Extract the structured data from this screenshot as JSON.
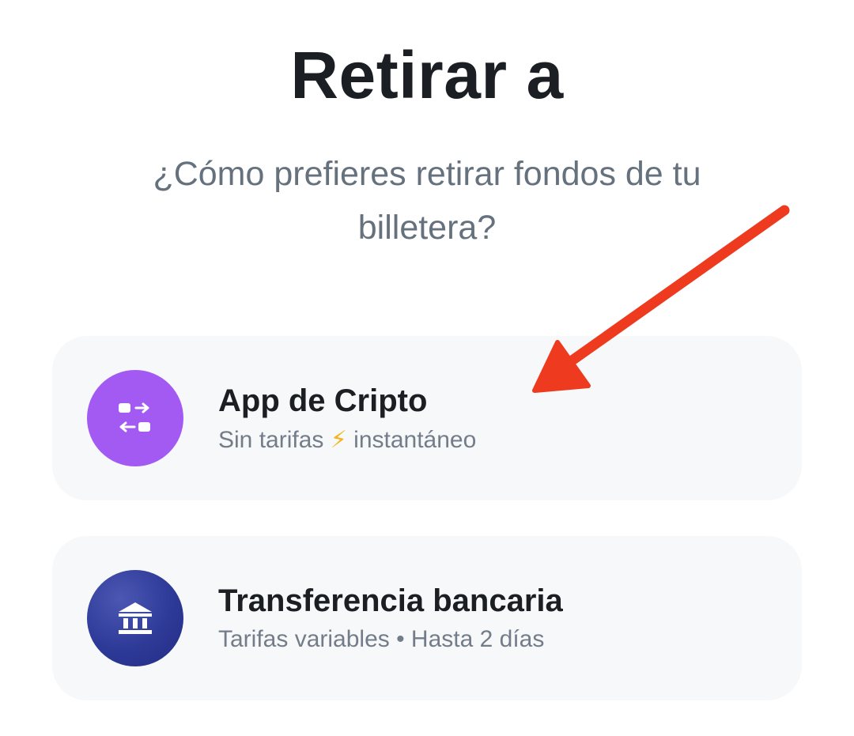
{
  "header": {
    "title": "Retirar a",
    "subtitle": "¿Cómo prefieres retirar fondos de tu billetera?"
  },
  "options": [
    {
      "title": "App de Cripto",
      "subtitle_before": "Sin tarifas",
      "subtitle_icon": "⚡",
      "subtitle_after": "instantáneo",
      "icon": "transfer-icon",
      "color": "#a35af3"
    },
    {
      "title": "Transferencia bancaria",
      "subtitle": "Tarifas variables • Hasta 2 días",
      "icon": "bank-icon",
      "color": "#2e3a97"
    }
  ],
  "annotation": {
    "arrow_color": "#ee3a1f"
  }
}
